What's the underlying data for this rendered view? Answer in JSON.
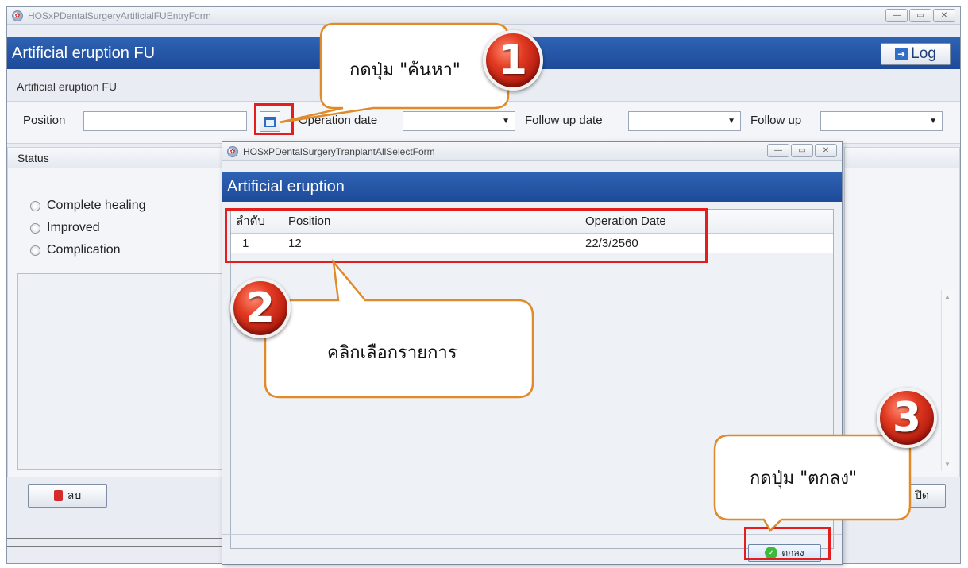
{
  "main_window": {
    "title": "HOSxPDentalSurgeryArtificialFUEntryForm",
    "header_title": "Artificial eruption FU",
    "log_button": "Log",
    "group_label": "Artificial eruption FU",
    "fields": {
      "position_label": "Position",
      "operation_date_label": "Operation date",
      "follow_up_date_label": "Follow up date",
      "follow_up_label": "Follow up"
    },
    "status": {
      "header": "Status",
      "options": [
        "Complete healing",
        "Improved",
        "Complication"
      ]
    },
    "delete_button": "ลบ",
    "close_button": "ปิด"
  },
  "dialog": {
    "title": "HOSxPDentalSurgeryTranplantAllSelectForm",
    "header_title": "Artificial eruption",
    "columns": [
      "ลำดับ",
      "Position",
      "Operation Date"
    ],
    "rows": [
      {
        "no": "1",
        "position": "12",
        "operation_date": "22/3/2560"
      }
    ],
    "ok_button": "ตกลง"
  },
  "annotations": {
    "step1": {
      "number": "1",
      "text": "กดปุ่ม \"ค้นหา\""
    },
    "step2": {
      "number": "2",
      "text": "คลิกเลือกรายการ"
    },
    "step3": {
      "number": "3",
      "text": "กดปุ่ม \"ตกลง\""
    },
    "highlight_color": "#e41e1e",
    "badge_color": "#e23a22",
    "callout_border_color": "#e08a2a"
  },
  "icons": {
    "app": "app-logo-icon",
    "log": "logout-icon",
    "search": "search-list-icon",
    "delete": "trash-icon",
    "ok": "checkmark-icon"
  }
}
